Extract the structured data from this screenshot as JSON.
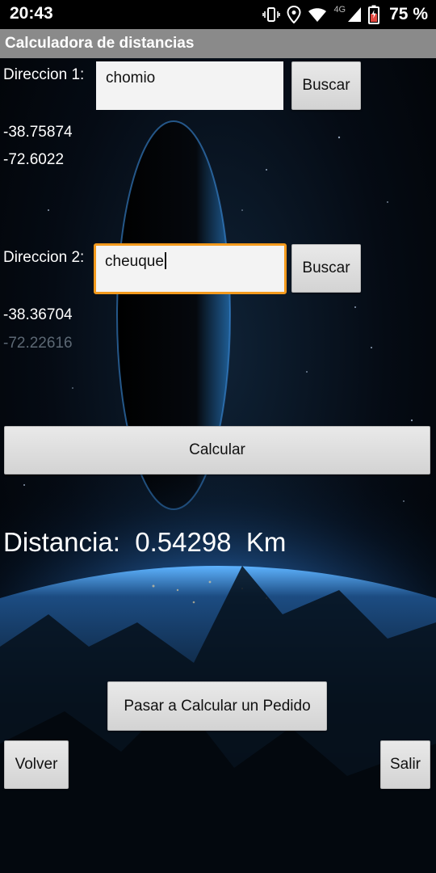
{
  "status_bar": {
    "time": "20:43",
    "network": "4G",
    "battery_percent": "75 %"
  },
  "app": {
    "title": "Calculadora de distancias"
  },
  "direccion1": {
    "label": "Direccion 1:",
    "value": "chomio",
    "buscar_label": "Buscar",
    "lat": "-38.75874",
    "lon": "-72.6022"
  },
  "direccion2": {
    "label": "Direccion 2:",
    "value": "cheuque",
    "buscar_label": "Buscar",
    "lat": "-38.36704",
    "lon": "-72.22616"
  },
  "calcular_label": "Calcular",
  "result": {
    "prefix": "Distancia:",
    "value": "0.54298",
    "unit": "Km"
  },
  "pedido_label": "Pasar a Calcular un Pedido",
  "volver_label": "Volver",
  "salir_label": "Salir",
  "colors": {
    "focus_border": "#f39a1d",
    "titlebar": "#8a8a8a",
    "planet_glow": "#4aa8ff"
  }
}
